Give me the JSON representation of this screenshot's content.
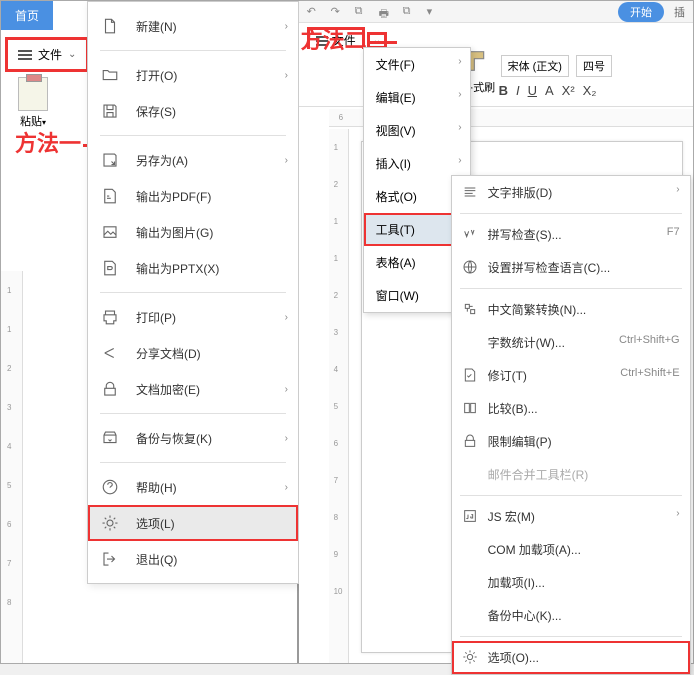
{
  "left": {
    "tab_home": "首页",
    "file_label": "文件",
    "paste_label": "粘贴",
    "annotation": "方法一",
    "menu": [
      {
        "label": "新建(N)",
        "icon": "new",
        "arrow": true
      },
      {
        "label": "打开(O)",
        "icon": "open",
        "arrow": true
      },
      {
        "label": "保存(S)",
        "icon": "save"
      },
      {
        "label": "另存为(A)",
        "icon": "saveas",
        "arrow": true
      },
      {
        "label": "输出为PDF(F)",
        "icon": "pdf"
      },
      {
        "label": "输出为图片(G)",
        "icon": "img"
      },
      {
        "label": "输出为PPTX(X)",
        "icon": "pptx"
      },
      {
        "label": "打印(P)",
        "icon": "print",
        "arrow": true
      },
      {
        "label": "分享文档(D)",
        "icon": "share"
      },
      {
        "label": "文档加密(E)",
        "icon": "lock",
        "arrow": true
      },
      {
        "label": "备份与恢复(K)",
        "icon": "backup",
        "arrow": true
      },
      {
        "label": "帮助(H)",
        "icon": "help",
        "arrow": true
      },
      {
        "label": "选项(L)",
        "icon": "option",
        "hov": true,
        "boxed": true
      },
      {
        "label": "退出(Q)",
        "icon": "exit"
      }
    ],
    "ruler_v": [
      "1",
      "1",
      "2",
      "3",
      "4",
      "5",
      "6",
      "7",
      "8"
    ]
  },
  "right": {
    "annotation": "方法二",
    "file_label": "文件",
    "start_label": "开始",
    "insert_label": "插",
    "brush_label": "各式刷",
    "font_name": "宋体 (正文)",
    "font_size": "四号",
    "fmt": {
      "bold": "B",
      "italic": "I",
      "underline": "U",
      "strike": "A",
      "sup": "X²",
      "sub": "X₂"
    },
    "ruler_h": [
      "6",
      "4"
    ],
    "ruler_v": [
      "1",
      "2",
      "1",
      "1",
      "2",
      "3",
      "4",
      "5",
      "6",
      "7",
      "8",
      "9",
      "10"
    ],
    "sub1": [
      {
        "label": "文件(F)",
        "arrow": true
      },
      {
        "label": "编辑(E)",
        "arrow": true
      },
      {
        "label": "视图(V)",
        "arrow": true
      },
      {
        "label": "插入(I)",
        "arrow": true
      },
      {
        "label": "格式(O)",
        "arrow": true
      },
      {
        "label": "工具(T)",
        "arrow": true,
        "hl": true
      },
      {
        "label": "表格(A)",
        "arrow": true
      },
      {
        "label": "窗口(W)",
        "arrow": true
      }
    ],
    "sub2": [
      {
        "label": "文字排版(D)",
        "icon": "text",
        "arrow": true
      },
      {
        "sep": true
      },
      {
        "label": "拼写检查(S)...",
        "icon": "spell",
        "shortcut": "F7"
      },
      {
        "label": "设置拼写检查语言(C)...",
        "icon": "lang"
      },
      {
        "sep": true
      },
      {
        "label": "中文简繁转换(N)...",
        "icon": "cn"
      },
      {
        "label": "字数统计(W)...",
        "shortcut": "Ctrl+Shift+G"
      },
      {
        "label": "修订(T)",
        "icon": "rev",
        "shortcut": "Ctrl+Shift+E"
      },
      {
        "label": "比较(B)...",
        "icon": "comp"
      },
      {
        "label": "限制编辑(P)",
        "icon": "limit"
      },
      {
        "label": "邮件合并工具栏(R)",
        "dis": true
      },
      {
        "sep": true
      },
      {
        "label": "JS 宏(M)",
        "icon": "js",
        "arrow": true
      },
      {
        "label": "COM 加载项(A)..."
      },
      {
        "label": "加载项(I)..."
      },
      {
        "label": "备份中心(K)..."
      },
      {
        "sep": true
      },
      {
        "label": "选项(O)...",
        "icon": "option",
        "boxed": true
      }
    ]
  }
}
